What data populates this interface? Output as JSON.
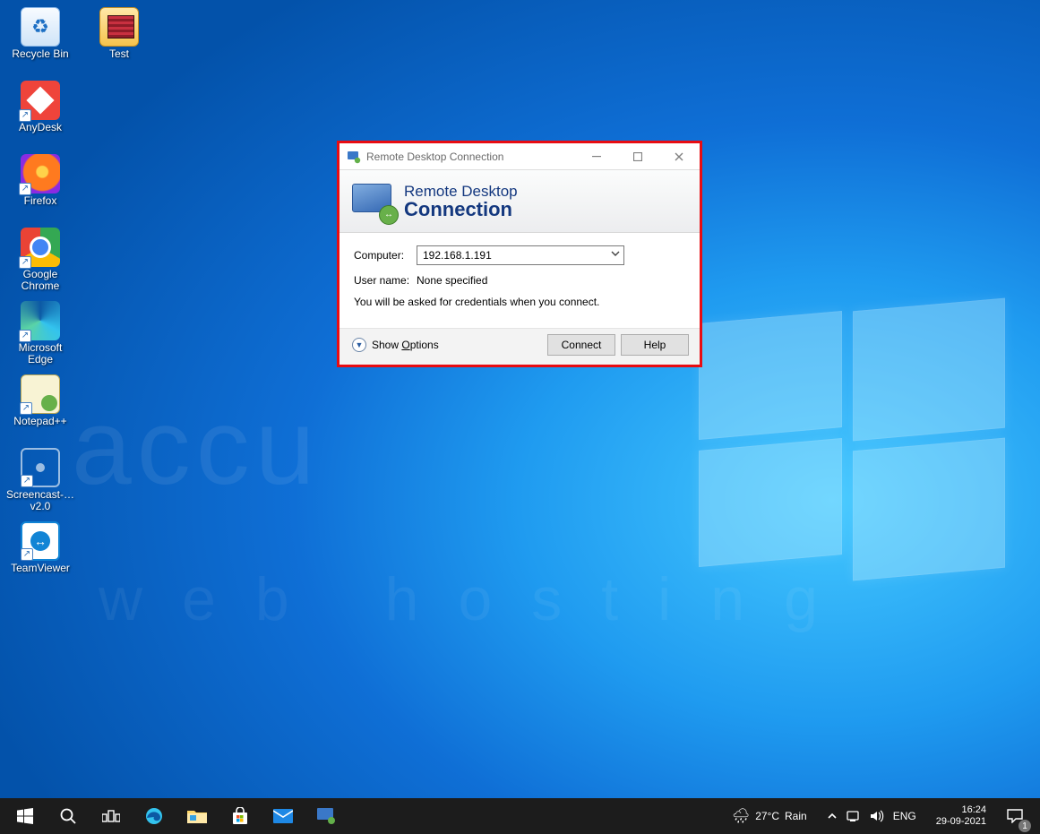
{
  "desktop": {
    "icons_col1": [
      {
        "name": "recycle-bin",
        "label": "Recycle Bin",
        "cls": "i-recycle",
        "shortcut": false
      },
      {
        "name": "anydesk",
        "label": "AnyDesk",
        "cls": "i-anydesk",
        "shortcut": true
      },
      {
        "name": "firefox",
        "label": "Firefox",
        "cls": "i-firefox",
        "shortcut": true
      },
      {
        "name": "google-chrome",
        "label": "Google Chrome",
        "cls": "i-chrome",
        "shortcut": true
      },
      {
        "name": "microsoft-edge",
        "label": "Microsoft Edge",
        "cls": "i-edge",
        "shortcut": true
      },
      {
        "name": "notepad-pp",
        "label": "Notepad++",
        "cls": "i-npp",
        "shortcut": true
      },
      {
        "name": "screencast",
        "label": "Screencast-… v2.0",
        "cls": "i-sc",
        "shortcut": true
      },
      {
        "name": "teamviewer",
        "label": "TeamViewer",
        "cls": "i-tv",
        "shortcut": true
      }
    ],
    "icons_col2": [
      {
        "name": "test-folder",
        "label": "Test",
        "cls": "i-folder",
        "shortcut": false
      }
    ]
  },
  "watermark": {
    "line1": "accu",
    "line2": "web hosting"
  },
  "rdp": {
    "title": "Remote Desktop Connection",
    "banner_line1": "Remote Desktop",
    "banner_line2": "Connection",
    "computer_label": "Computer:",
    "computer_value": "192.168.1.191",
    "username_label": "User name:",
    "username_value": "None specified",
    "hint": "You will be asked for credentials when you connect.",
    "show_options_prefix": "Show ",
    "show_options_u": "O",
    "show_options_suffix": "ptions",
    "connect": "Connect",
    "help": "Help"
  },
  "taskbar": {
    "pinned": [
      {
        "name": "start",
        "icon": "win"
      },
      {
        "name": "search",
        "icon": "search"
      },
      {
        "name": "task-view",
        "icon": "taskview"
      },
      {
        "name": "edge",
        "icon": "edge"
      },
      {
        "name": "file-explorer",
        "icon": "explorer"
      },
      {
        "name": "microsoft-store",
        "icon": "store"
      },
      {
        "name": "mail",
        "icon": "mail"
      },
      {
        "name": "remote-desktop",
        "icon": "rdp"
      }
    ],
    "weather": {
      "temp": "27°C",
      "cond": "Rain"
    },
    "lang": "ENG",
    "time": "16:24",
    "date": "29-09-2021",
    "notifications": "1"
  }
}
